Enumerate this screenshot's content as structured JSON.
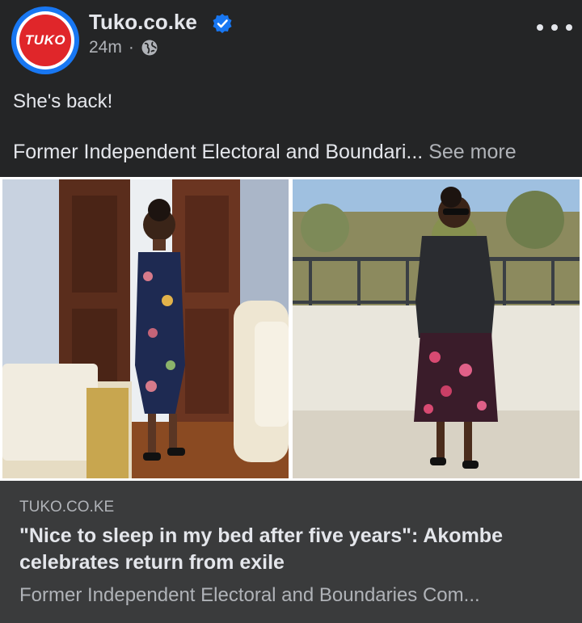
{
  "post": {
    "avatar_text": "TUKO",
    "page_name": "Tuko.co.ke",
    "timestamp": "24m",
    "separator": "·",
    "privacy_icon": "globe-icon",
    "verified_icon": "verified-badge-icon",
    "more_icon": "more-options-icon",
    "caption_line1": "She's back!",
    "caption_line2": "Former Independent Electoral and Boundari...",
    "see_more": "See more"
  },
  "link_preview": {
    "domain": "TUKO.CO.KE",
    "title": "\"Nice to sleep in my bed after five years\": Akombe celebrates return from exile",
    "description": "Former Independent Electoral and Boundaries Com..."
  },
  "colors": {
    "background": "#242526",
    "link_box": "#3a3b3c",
    "brand_blue": "#1877f2",
    "brand_red": "#e0262a",
    "text_primary": "#e4e6eb",
    "text_secondary": "#b0b3b8"
  }
}
